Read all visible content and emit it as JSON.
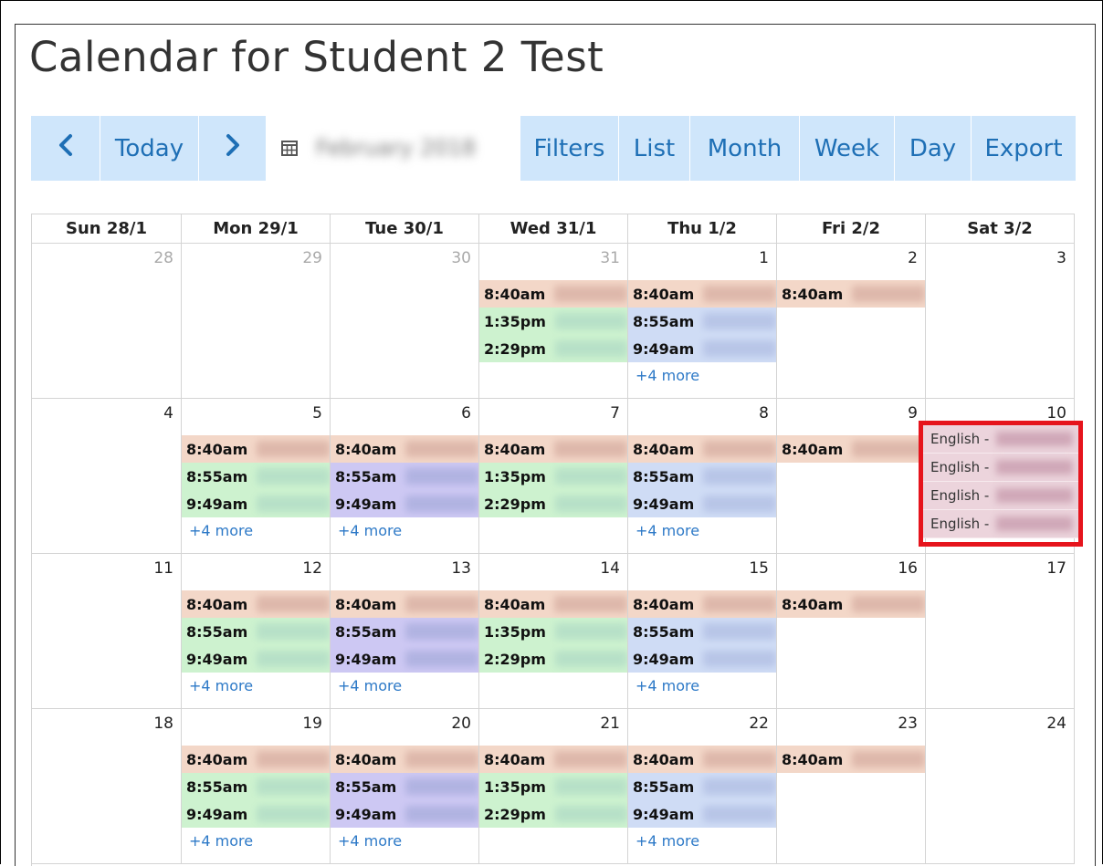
{
  "page": {
    "title": "Calendar for Student 2 Test"
  },
  "toolbar": {
    "prev_icon": "chevron-left-icon",
    "today_label": "Today",
    "next_icon": "chevron-right-icon",
    "calendar_icon": "calendar-icon",
    "date_range": "February 2018",
    "filters_label": "Filters",
    "list_label": "List",
    "month_label": "Month",
    "week_label": "Week",
    "day_label": "Day",
    "export_label": "Export",
    "accent_bg": "#cfe6fb",
    "accent_text": "#1e6fb5"
  },
  "headers": [
    "Sun 28/1",
    "Mon 29/1",
    "Tue 30/1",
    "Wed 31/1",
    "Thu 1/2",
    "Fri 2/2",
    "Sat 3/2"
  ],
  "more_label": "+4 more",
  "weeks": [
    {
      "days": [
        {
          "num": "28",
          "other": true,
          "events": []
        },
        {
          "num": "29",
          "other": true,
          "events": []
        },
        {
          "num": "30",
          "other": true,
          "events": []
        },
        {
          "num": "31",
          "other": true,
          "events": [
            {
              "time": "8:40am",
              "color": "salmon"
            },
            {
              "time": "1:35pm",
              "color": "green"
            },
            {
              "time": "2:29pm",
              "color": "green"
            }
          ]
        },
        {
          "num": "1",
          "events": [
            {
              "time": "8:40am",
              "color": "salmon"
            },
            {
              "time": "8:55am",
              "color": "blue"
            },
            {
              "time": "9:49am",
              "color": "blue"
            }
          ],
          "more": true
        },
        {
          "num": "2",
          "events": [
            {
              "time": "8:40am",
              "color": "salmon"
            }
          ]
        },
        {
          "num": "3",
          "events": []
        }
      ]
    },
    {
      "days": [
        {
          "num": "4",
          "events": []
        },
        {
          "num": "5",
          "events": [
            {
              "time": "8:40am",
              "color": "salmon"
            },
            {
              "time": "8:55am",
              "color": "green"
            },
            {
              "time": "9:49am",
              "color": "green"
            }
          ],
          "more": true
        },
        {
          "num": "6",
          "events": [
            {
              "time": "8:40am",
              "color": "salmon"
            },
            {
              "time": "8:55am",
              "color": "purple"
            },
            {
              "time": "9:49am",
              "color": "purple"
            }
          ],
          "more": true
        },
        {
          "num": "7",
          "events": [
            {
              "time": "8:40am",
              "color": "salmon"
            },
            {
              "time": "1:35pm",
              "color": "green"
            },
            {
              "time": "2:29pm",
              "color": "green"
            }
          ]
        },
        {
          "num": "8",
          "events": [
            {
              "time": "8:40am",
              "color": "salmon"
            },
            {
              "time": "8:55am",
              "color": "blue"
            },
            {
              "time": "9:49am",
              "color": "blue"
            }
          ],
          "more": true
        },
        {
          "num": "9",
          "events": [
            {
              "time": "8:40am",
              "color": "salmon"
            }
          ]
        },
        {
          "num": "10",
          "events": [],
          "english": [
            "English -",
            "English -",
            "English -",
            "English -"
          ]
        }
      ]
    },
    {
      "days": [
        {
          "num": "11",
          "events": []
        },
        {
          "num": "12",
          "events": [
            {
              "time": "8:40am",
              "color": "salmon"
            },
            {
              "time": "8:55am",
              "color": "green"
            },
            {
              "time": "9:49am",
              "color": "green"
            }
          ],
          "more": true
        },
        {
          "num": "13",
          "events": [
            {
              "time": "8:40am",
              "color": "salmon"
            },
            {
              "time": "8:55am",
              "color": "purple"
            },
            {
              "time": "9:49am",
              "color": "purple"
            }
          ],
          "more": true
        },
        {
          "num": "14",
          "events": [
            {
              "time": "8:40am",
              "color": "salmon"
            },
            {
              "time": "1:35pm",
              "color": "green"
            },
            {
              "time": "2:29pm",
              "color": "green"
            }
          ]
        },
        {
          "num": "15",
          "events": [
            {
              "time": "8:40am",
              "color": "salmon"
            },
            {
              "time": "8:55am",
              "color": "blue"
            },
            {
              "time": "9:49am",
              "color": "blue"
            }
          ],
          "more": true
        },
        {
          "num": "16",
          "events": [
            {
              "time": "8:40am",
              "color": "salmon"
            }
          ]
        },
        {
          "num": "17",
          "events": []
        }
      ]
    },
    {
      "days": [
        {
          "num": "18",
          "events": []
        },
        {
          "num": "19",
          "events": [
            {
              "time": "8:40am",
              "color": "salmon"
            },
            {
              "time": "8:55am",
              "color": "green"
            },
            {
              "time": "9:49am",
              "color": "green"
            }
          ],
          "more": true
        },
        {
          "num": "20",
          "events": [
            {
              "time": "8:40am",
              "color": "salmon"
            },
            {
              "time": "8:55am",
              "color": "purple"
            },
            {
              "time": "9:49am",
              "color": "purple"
            }
          ],
          "more": true
        },
        {
          "num": "21",
          "events": [
            {
              "time": "8:40am",
              "color": "salmon"
            },
            {
              "time": "1:35pm",
              "color": "green"
            },
            {
              "time": "2:29pm",
              "color": "green"
            }
          ]
        },
        {
          "num": "22",
          "events": [
            {
              "time": "8:40am",
              "color": "salmon"
            },
            {
              "time": "8:55am",
              "color": "blue"
            },
            {
              "time": "9:49am",
              "color": "blue"
            }
          ],
          "more": true
        },
        {
          "num": "23",
          "events": [
            {
              "time": "8:40am",
              "color": "salmon"
            }
          ]
        },
        {
          "num": "24",
          "events": []
        }
      ]
    }
  ],
  "highlight_color": "#e6141c"
}
